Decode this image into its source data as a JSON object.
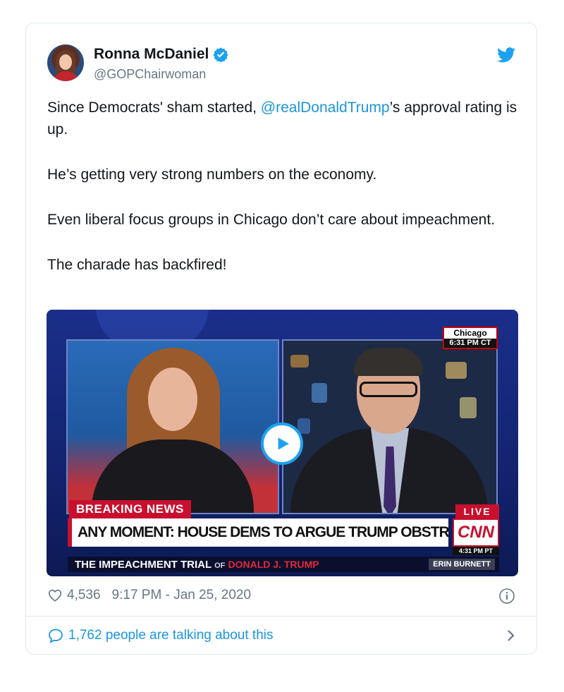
{
  "tweet": {
    "author_name": "Ronna McDaniel",
    "author_handle": "@GOPChairwoman",
    "verified": true,
    "paragraphs": [
      {
        "before": "Since Democrats' sham started, ",
        "mention": "@realDonaldTrump",
        "after": "’s approval rating is up."
      },
      {
        "text": "He’s getting very strong numbers on the economy."
      },
      {
        "text": "Even liberal focus groups in Chicago don’t care about impeachment."
      },
      {
        "text": "The charade has backfired!"
      }
    ],
    "likes": "4,536",
    "timestamp": "9:17 PM - Jan 25, 2020",
    "talking": "1,762 people are talking about this"
  },
  "video": {
    "location": "Chicago",
    "location_time": "6:31 PM CT",
    "breaking_label": "BREAKING NEWS",
    "live_label": "LIVE",
    "headline": "ANY MOMENT: HOUSE DEMS TO ARGUE TRUMP OBSTRUCTED CONGRESS",
    "network": "CNN",
    "network_time": "4:31 PM PT",
    "ticker_part1": "THE IMPEACHMENT TRIAL",
    "ticker_of": "OF",
    "ticker_part2": "DONALD J. TRUMP",
    "anchor": "ERIN BURNETT"
  },
  "icons": {
    "verified": "verified-badge-icon",
    "twitter": "twitter-bird-icon",
    "play": "play-icon",
    "like": "heart-icon",
    "info": "info-icon",
    "comment": "speech-bubble-icon",
    "chevron": "chevron-right-icon"
  },
  "colors": {
    "accent": "#1da1f2",
    "link": "#1b95e0",
    "muted": "#657786",
    "cnn_red": "#c8102e"
  }
}
